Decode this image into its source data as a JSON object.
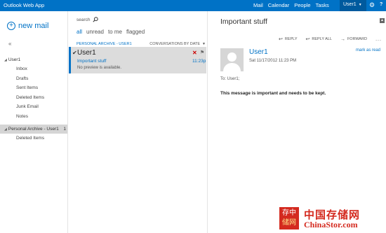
{
  "topbar": {
    "app_title": "Outlook Web App",
    "nav": [
      "Mail",
      "Calendar",
      "People",
      "Tasks"
    ],
    "user": "User1",
    "help": "?"
  },
  "left": {
    "new_mail": "new mail",
    "collapse": "«",
    "mailbox": {
      "name": "User1",
      "folders": [
        "Inbox",
        "Drafts",
        "Sent Items",
        "Deleted Items",
        "Junk Email",
        "Notes"
      ]
    },
    "archive": {
      "name": "Personal Archive - User1",
      "count": "1",
      "folders": [
        "Deleted Items"
      ]
    }
  },
  "middle": {
    "search_label": "search",
    "filters": [
      "all",
      "unread",
      "to me",
      "flagged"
    ],
    "list_title": "PERSONAL ARCHIVE - USER1",
    "sort_label": "CONVERSATIONS BY DATE",
    "message": {
      "sender": "User1",
      "subject": "Important stuff",
      "time": "11:23p",
      "preview": "No preview is available."
    }
  },
  "reading": {
    "subject": "Important stuff",
    "actions": {
      "reply": "REPLY",
      "reply_all": "REPLY ALL",
      "forward": "FORWARD",
      "more": "..."
    },
    "from": "User1",
    "mark_as_read": "mark as read",
    "sent": "Sat 11/17/2012 11:23 PM",
    "to": "To: User1;",
    "body": "This message is important and needs to be kept."
  },
  "watermark": {
    "seal_top": "存中",
    "seal_bottom": "储网",
    "cn": "中国存储网",
    "en": "ChinaStor.com"
  },
  "colors": {
    "accent": "#0072c6",
    "topbar": "#0072c6",
    "selected_row": "#dcdcdc",
    "delete": "#cc0000",
    "watermark": "#d42a1f"
  },
  "icons": {
    "search": "magnifier-icon",
    "new_mail": "plus-circle-icon",
    "settings": "gear-icon",
    "reply": "reply-arrow-icon",
    "reply_all": "reply-all-arrow-icon",
    "forward": "forward-arrow-icon",
    "flag": "flag-icon",
    "delete": "x-icon",
    "check": "checkmark-icon",
    "avatar": "person-silhouette-icon"
  }
}
